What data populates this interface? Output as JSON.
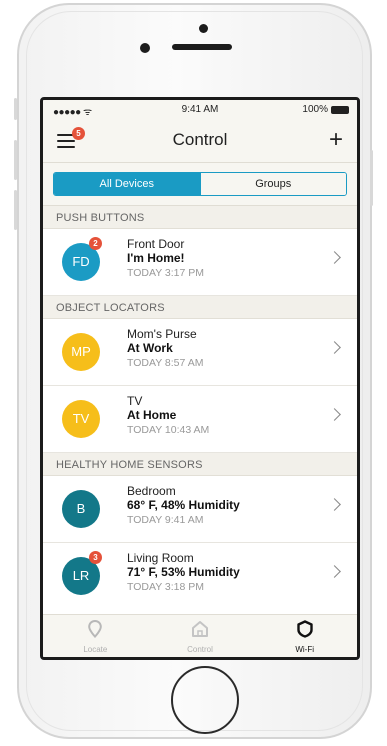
{
  "status_bar": {
    "signal": "●●●●● ᯤ",
    "time": "9:41 AM",
    "battery": "100%"
  },
  "nav": {
    "title": "Control",
    "menu_badge": "5",
    "add_label": "+"
  },
  "segments": {
    "all": "All Devices",
    "groups": "Groups"
  },
  "sections": [
    {
      "title": "PUSH BUTTONS",
      "rows": [
        {
          "initials": "FD",
          "badge": "2",
          "name": "Front Door",
          "status": "I'm Home!",
          "time": "TODAY 3:17 PM",
          "color": "#1b9bc4"
        }
      ]
    },
    {
      "title": "OBJECT LOCATORS",
      "rows": [
        {
          "initials": "MP",
          "name": "Mom's Purse",
          "status": "At Work",
          "time": "TODAY 8:57 AM",
          "color": "#f6be1a"
        },
        {
          "initials": "TV",
          "name": "TV",
          "status": "At Home",
          "time": "TODAY 10:43 AM",
          "color": "#f6be1a"
        }
      ]
    },
    {
      "title": "HEALTHY HOME SENSORS",
      "rows": [
        {
          "initials": "B",
          "name": "Bedroom",
          "status": "68° F, 48% Humidity",
          "time": "TODAY 9:41 AM",
          "color": "#137889"
        },
        {
          "initials": "LR",
          "badge": "3",
          "name": "Living Room",
          "status": "71° F, 53% Humidity",
          "time": "TODAY 3:18 PM",
          "color": "#137889"
        }
      ]
    }
  ],
  "tabs": [
    {
      "label": "Locate",
      "icon": "location-pin-icon",
      "active": false
    },
    {
      "label": "Control",
      "icon": "home-icon",
      "active": false
    },
    {
      "label": "Wi-Fi",
      "icon": "shield-icon",
      "active": true
    }
  ],
  "colors": {
    "accent": "#1a9bc4",
    "badge": "#e5523a",
    "tab_inactive": "#b8b8b8",
    "tab_active": "#111111"
  }
}
